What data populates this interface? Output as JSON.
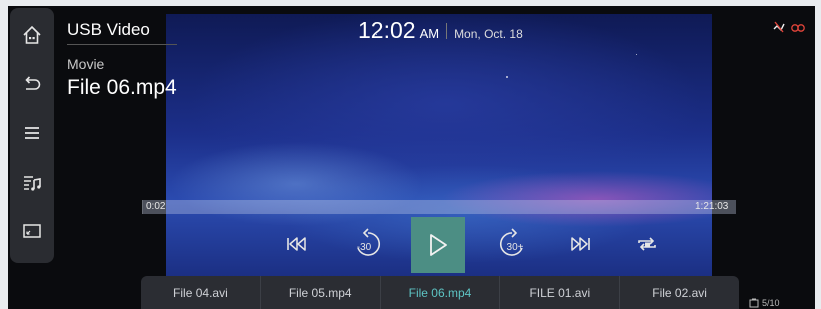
{
  "header": {
    "app_title": "USB Video",
    "category": "Movie",
    "filename": "File 06.mp4"
  },
  "clock": {
    "time": "12:02",
    "ampm": "AM",
    "date": "Mon, Oct. 18"
  },
  "nav": {
    "items": [
      {
        "name": "home-icon"
      },
      {
        "name": "back-icon"
      },
      {
        "name": "menu-icon"
      },
      {
        "name": "playlist-icon"
      },
      {
        "name": "screen-mode-icon"
      }
    ]
  },
  "status_icons": [
    "audio-off-icon",
    "connected-car-icon"
  ],
  "playback": {
    "elapsed": "0:02",
    "duration": "1:21:03",
    "progress_fraction": 0.0004
  },
  "controls": {
    "rewind_label": "-30",
    "forward_label": "30+"
  },
  "playlist": {
    "items": [
      "File 04.avi",
      "File 05.mp4",
      "File 06.mp4",
      "FILE 01.avi",
      "File 02.avi"
    ],
    "active_index": 2,
    "count": "5/10"
  },
  "colors": {
    "accent": "#5ec4c4",
    "play_button": "#4c8e84",
    "status_red": "#e0443a"
  }
}
